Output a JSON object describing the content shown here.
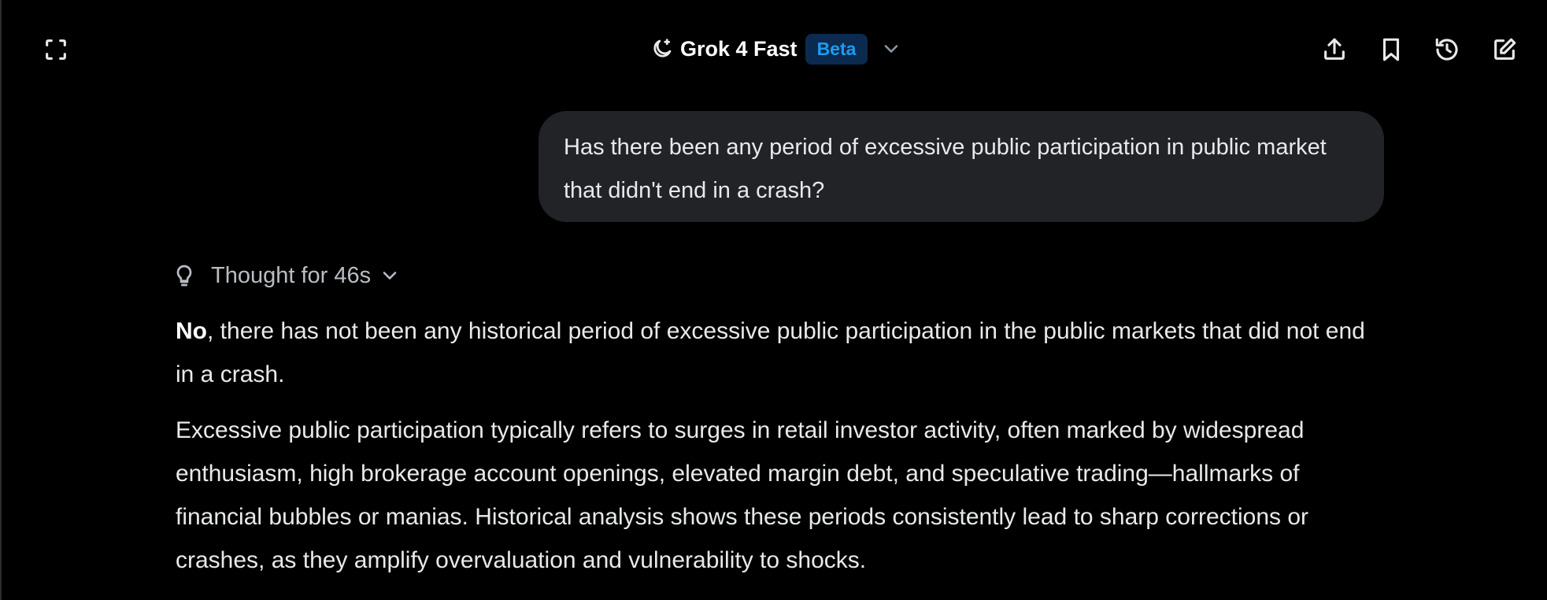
{
  "header": {
    "model_name": "Grok 4 Fast",
    "badge": "Beta",
    "icons": {
      "fullscreen": "expand-icon",
      "model": "moon-sparkle-icon",
      "dropdown": "chevron-down-icon",
      "share": "share-upload-icon",
      "bookmark": "bookmark-icon",
      "history": "history-icon",
      "new_chat": "edit-icon"
    }
  },
  "conversation": {
    "user_message": "Has there been any period of excessive public participation in public market that didn't end in a crash?",
    "thought": {
      "label": "Thought for 46s",
      "icon": "lightbulb-icon"
    },
    "answer": {
      "p1_bold": "No",
      "p1_rest": ", there has not been any historical period of excessive public participation in the public markets that did not end in a crash.",
      "p2": "Excessive public participation typically refers to surges in retail investor activity, often marked by widespread enthusiasm, high brokerage account openings, elevated margin debt, and speculative trading—hallmarks of financial bubbles or manias. Historical analysis shows these periods consistently lead to sharp corrections or crashes, as they amplify overvaluation and vulnerability to shocks."
    }
  },
  "colors": {
    "background": "#000000",
    "bubble": "#212327",
    "text": "#e7e9ea",
    "badge_bg": "#0b2a4f",
    "badge_text": "#1d9bf0"
  }
}
